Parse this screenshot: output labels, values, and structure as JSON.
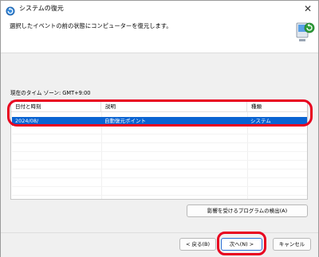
{
  "window": {
    "title": "システムの復元",
    "close_glyph": "✕"
  },
  "header": {
    "instruction": "選択したイベントの前の状態にコンピューターを復元します。"
  },
  "timezone": {
    "label": "現在のタイム ゾーン: GMT+9:00"
  },
  "list": {
    "columns": [
      "日付と時刻",
      "説明",
      "種類"
    ],
    "rows": [
      {
        "datetime": "2024/08/",
        "description": "自動復元ポイント",
        "type": "システム",
        "selected": true
      }
    ]
  },
  "buttons": {
    "scan_label": "影響を受けるプログラムの検出(A)",
    "back_label": "< 戻る(B)",
    "next_label": "次へ(N) >",
    "cancel_label": "キャンセル"
  },
  "colors": {
    "selection": "#0a64d2",
    "annotation": "#e8001f",
    "primary_border": "#2a6fd6"
  },
  "icons": {
    "app": "system-restore-icon",
    "header_art": "computer-restore-icon",
    "close": "close-icon"
  }
}
